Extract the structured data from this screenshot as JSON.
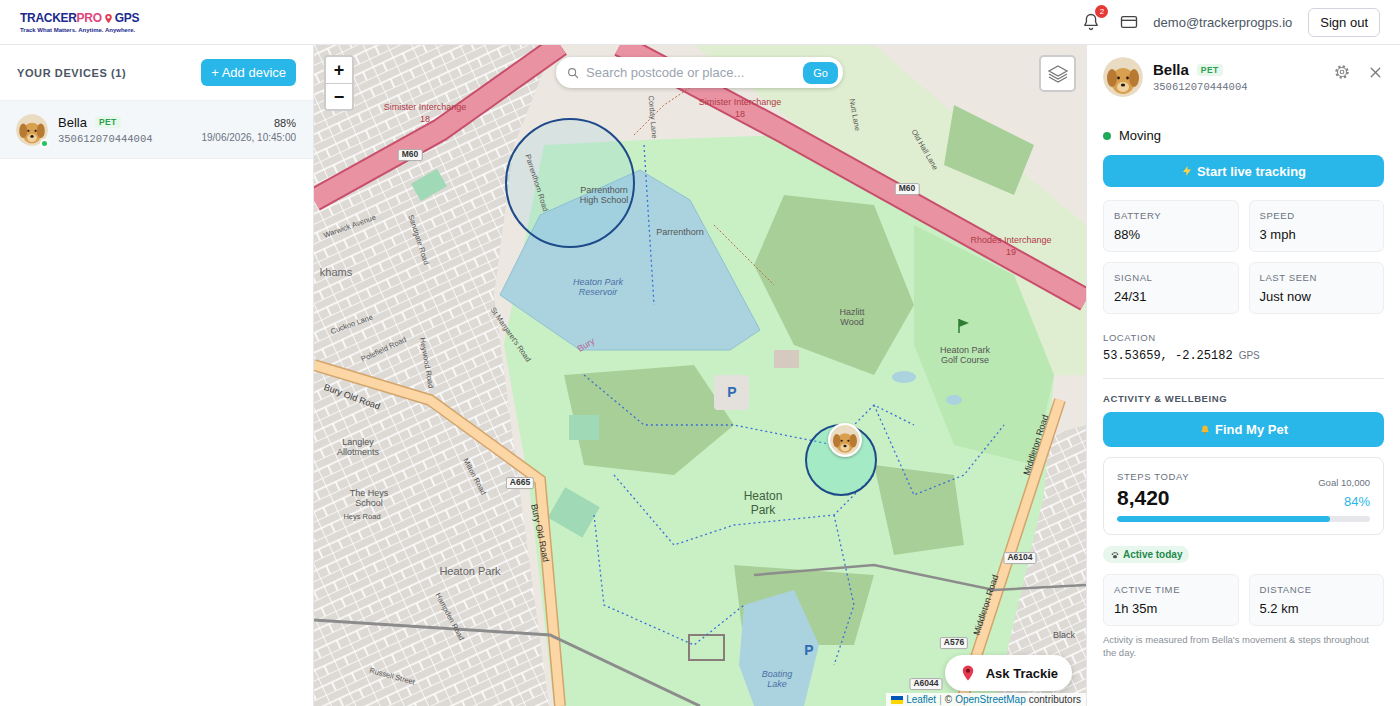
{
  "header": {
    "logo": {
      "parts": [
        {
          "text": "TRACKER",
          "color": "#1b2a8c"
        },
        {
          "text": "PRO",
          "color": "#e0457b"
        },
        {
          "text": "GPS",
          "color": "#1b2a8c"
        }
      ],
      "tagline": "Track What Matters. Anytime. Anywhere."
    },
    "notifications": "2",
    "email": "demo@trackerprogps.io",
    "sign_out": "Sign out"
  },
  "sidebar": {
    "title": "YOUR DEVICES (1)",
    "add_button": "+ Add device",
    "devices": [
      {
        "name": "Bella",
        "tag": "PET",
        "imei": "350612070444004",
        "battery": "88%",
        "last_update": "19/06/2026, 10:45:00",
        "online": true,
        "selected": true
      }
    ]
  },
  "map": {
    "zoom_in": "+",
    "zoom_out": "−",
    "search": {
      "placeholder": "Search postcode or place...",
      "button": "Go"
    },
    "ask": "Ask Trackie",
    "attribution": {
      "leaflet": "Leaflet",
      "separator": "|",
      "prefix": "©",
      "link": "OpenStreetMap",
      "suffix": "contributors"
    },
    "labels": [
      {
        "text": "Simister Interchange",
        "kind": "junction"
      },
      {
        "text": "18",
        "kind": "junction"
      },
      {
        "text": "Simister Interchange",
        "kind": "junction"
      },
      {
        "text": "18",
        "kind": "junction"
      },
      {
        "text": "M60",
        "kind": "ref"
      },
      {
        "text": "M60",
        "kind": "ref"
      },
      {
        "text": "Rhodes Interchange",
        "kind": "junction"
      },
      {
        "text": "19",
        "kind": "junction"
      },
      {
        "text": "Parrenthorn High School",
        "kind": "area"
      },
      {
        "text": "Parrenthorn",
        "kind": "area"
      },
      {
        "text": "Heaton Park Reservoir",
        "kind": "water"
      },
      {
        "text": "Bury",
        "kind": "boundary"
      },
      {
        "text": "Hazlitt Wood",
        "kind": "area"
      },
      {
        "text": "Heaton Park Golf Course",
        "kind": "area"
      },
      {
        "text": "Heaton Park",
        "kind": "park"
      },
      {
        "text": "Boating Lake",
        "kind": "water"
      },
      {
        "text": "A665",
        "kind": "ref"
      },
      {
        "text": "Bury Old Road",
        "kind": "road"
      },
      {
        "text": "Bury Old Road",
        "kind": "road"
      },
      {
        "text": "Middleton Road",
        "kind": "road"
      },
      {
        "text": "Middleton Road",
        "kind": "road"
      },
      {
        "text": "A6104",
        "kind": "ref"
      },
      {
        "text": "A576",
        "kind": "ref"
      },
      {
        "text": "A6044",
        "kind": "ref"
      },
      {
        "text": "Langley Allotments",
        "kind": "area"
      },
      {
        "text": "The Heys School",
        "kind": "area"
      },
      {
        "text": "Heys Road",
        "kind": "street"
      },
      {
        "text": "Heaton Park",
        "kind": "suburb"
      },
      {
        "text": "khams",
        "kind": "suburb"
      },
      {
        "text": "Black",
        "kind": "area"
      },
      {
        "text": "P",
        "kind": "parking"
      },
      {
        "text": "P",
        "kind": "parking"
      },
      {
        "text": "Warwick Avenue",
        "kind": "street"
      },
      {
        "text": "Cuckoo Lane",
        "kind": "street"
      },
      {
        "text": "Polefield Road",
        "kind": "street"
      },
      {
        "text": "St Margaret's Road",
        "kind": "street"
      },
      {
        "text": "Heywood Road",
        "kind": "street"
      },
      {
        "text": "Sandgate Road",
        "kind": "street"
      },
      {
        "text": "Parrenthorn Road",
        "kind": "street"
      },
      {
        "text": "Corday Lane",
        "kind": "street"
      },
      {
        "text": "Nutt Lane",
        "kind": "street"
      },
      {
        "text": "Old Hall Lane",
        "kind": "street"
      },
      {
        "text": "Russell Street",
        "kind": "street"
      },
      {
        "text": "Hampden Road",
        "kind": "street"
      },
      {
        "text": "Milton Road",
        "kind": "street"
      }
    ]
  },
  "details": {
    "name": "Bella",
    "tag": "PET",
    "imei": "350612070444004",
    "status": "Moving",
    "moving": true,
    "live_button": "Start live tracking",
    "stats": [
      {
        "label": "BATTERY",
        "value": "88%"
      },
      {
        "label": "SPEED",
        "value": "3 mph"
      },
      {
        "label": "SIGNAL",
        "value": "24/31"
      },
      {
        "label": "LAST SEEN",
        "value": "Just now"
      }
    ],
    "location": {
      "label": "LOCATION",
      "coords": "53.53659, -2.25182",
      "source": "GPS"
    },
    "activity": {
      "title": "ACTIVITY & WELLBEING",
      "find_button": "Find My Pet",
      "steps": {
        "label": "STEPS TODAY",
        "value": "8,420",
        "goal": "Goal 10,000",
        "percent": "84%",
        "level": 0.84
      },
      "chip": "Active today",
      "metrics": [
        {
          "label": "ACTIVE TIME",
          "value": "1h 35m"
        },
        {
          "label": "DISTANCE",
          "value": "5.2 km"
        }
      ],
      "note": "Activity is measured from Bella's movement & steps throughout the day."
    }
  }
}
